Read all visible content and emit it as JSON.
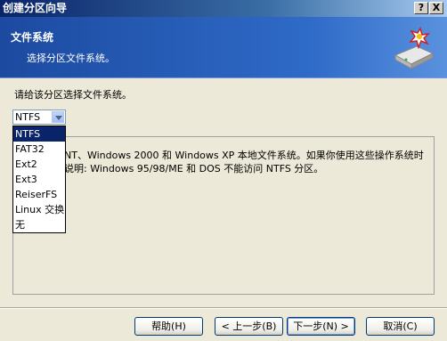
{
  "window": {
    "title": "创建分区向导",
    "help_btn": "?",
    "close_btn": "X"
  },
  "header": {
    "title": "文件系统",
    "subtitle": "选择分区文件系统。",
    "icon": "disk-wizard-icon"
  },
  "main": {
    "prompt": "请给该分区选择文件系统。",
    "filesystem_select": {
      "value": "NTFS",
      "options": [
        "NTFS",
        "FAT32",
        "Ext2",
        "Ext3",
        "ReiserFS",
        "Linux 交换",
        "无"
      ],
      "selected_index": 0
    },
    "description_line1": "NT、Windows 2000 和 Windows XP 本地文件系统。如果你使用这些操作系统时",
    "description_line2": "说明: Windows 95/98/ME 和 DOS 不能访问 NTFS 分区。"
  },
  "buttons": {
    "help": "帮助(H)",
    "back": "< 上一步(B)",
    "next": "下一步(N) >",
    "cancel": "取消(C)"
  },
  "colors": {
    "title_bar": "#0a246a",
    "header_bg": "#2f6bc8",
    "selection": "#0a246a",
    "dialog_bg": "#ece9d8"
  }
}
